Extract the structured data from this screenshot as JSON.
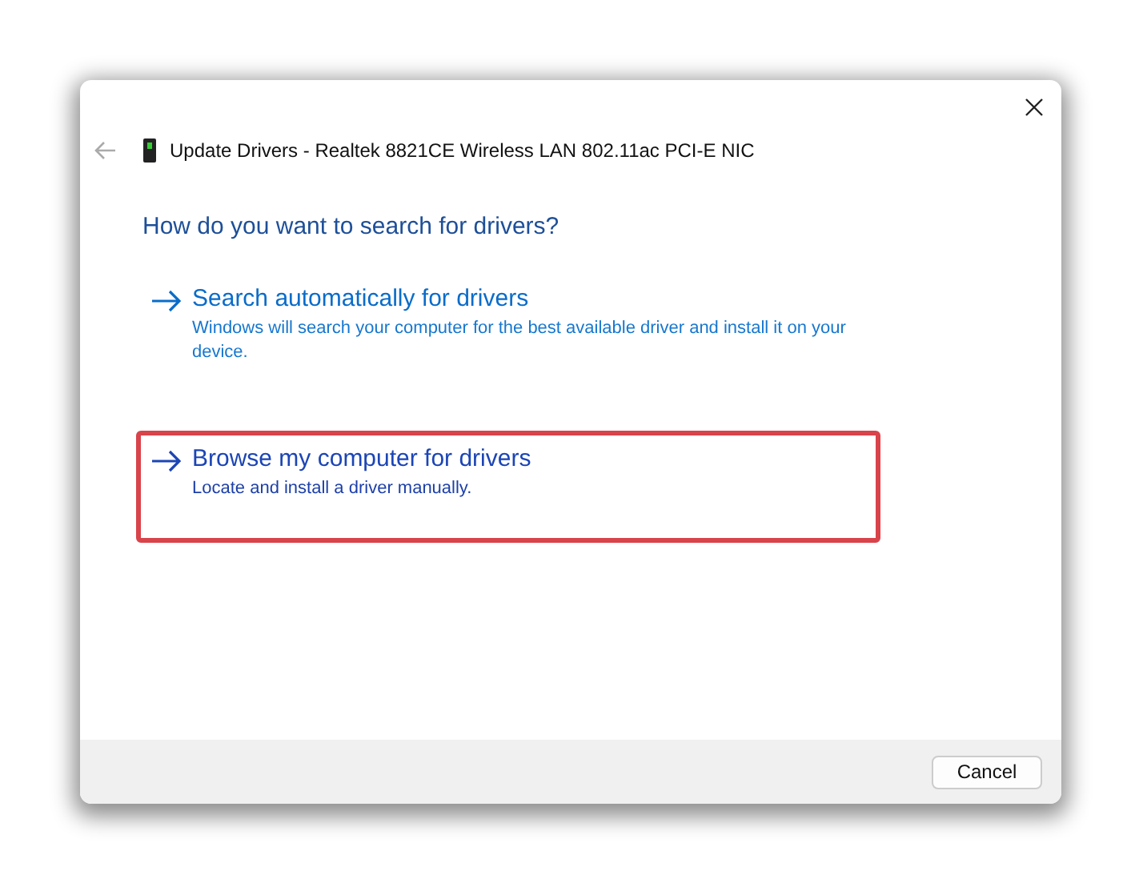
{
  "window": {
    "title": "Update Drivers - Realtek 8821CE Wireless LAN 802.11ac PCI-E NIC"
  },
  "heading": "How do you want to search for drivers?",
  "options": [
    {
      "title": "Search automatically for drivers",
      "description": "Windows will search your computer for the best available driver and install it on your device.",
      "highlighted": false
    },
    {
      "title": "Browse my computer for drivers",
      "description": "Locate and install a driver manually.",
      "highlighted": true
    }
  ],
  "buttons": [
    "Cancel"
  ]
}
